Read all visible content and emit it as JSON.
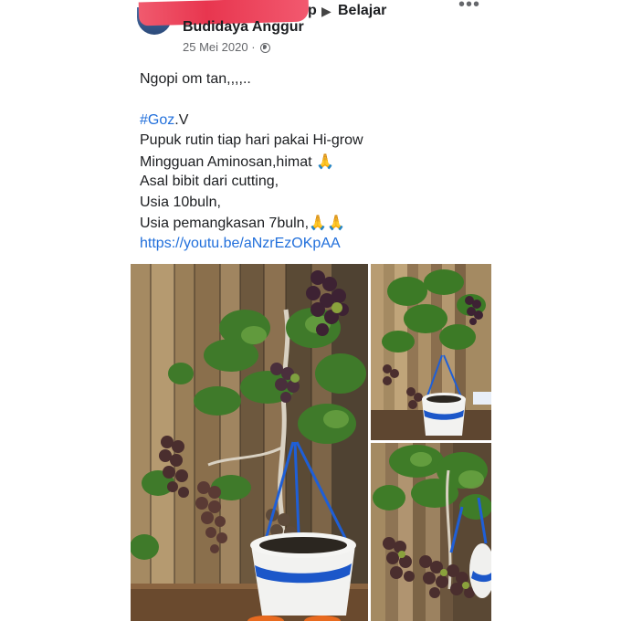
{
  "post": {
    "group_prefix_tail": "p",
    "group_arrow": "▶",
    "group_name_line1": "Belajar",
    "group_name_line2": "Budidaya Anggur",
    "date": "25 Mei 2020",
    "separator": "·",
    "more_glyph": "•••",
    "redaction_color": "#e8364f"
  },
  "content": {
    "line1": "Ngopi om tan,,,,..",
    "hashtag": "#Goz",
    "hashtag_suffix": ".V",
    "line3": "Pupuk rutin tiap hari pakai Hi-grow",
    "line4": "Mingguan Aminosan,himat",
    "line5": "Asal bibit dari cutting,",
    "line6": "Usia 10buln,",
    "line7": "Usia pemangkasan 7buln,",
    "emoji_pray": "🙏",
    "link": "https://youtu.be/aNzrEzOKpAA",
    "link_color": "#216fdb"
  },
  "photos": {
    "main": "grape-bonsai-main-photo",
    "top_right": "grape-bonsai-side-photo",
    "bottom_right": "grape-bonsai-closeup-photo"
  }
}
